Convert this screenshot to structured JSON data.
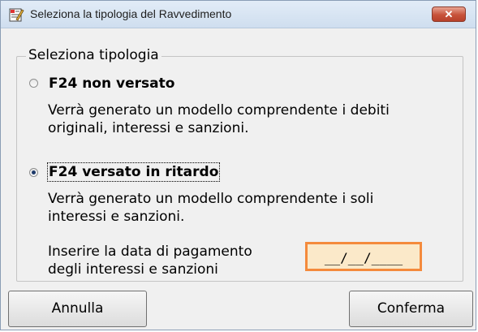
{
  "window": {
    "title": "Seleziona la tipologia del Ravvedimento",
    "icon": "edit-document-icon",
    "close_label": "✕"
  },
  "group": {
    "legend": "Seleziona tipologia"
  },
  "options": [
    {
      "label": "F24 non versato",
      "selected": false,
      "description_line1": "Verrà generato un modello comprendente i debiti",
      "description_line2": "originali, interessi e sanzioni."
    },
    {
      "label": "F24 versato in ritardo",
      "selected": true,
      "description_line1": "Verrà generato un modello comprendente i soli",
      "description_line2": "interessi e sanzioni."
    }
  ],
  "payment_date": {
    "label_line1": "Inserire la data di pagamento",
    "label_line2": "degli interessi e sanzioni",
    "value": "__/__/____",
    "highlight_color": "#f48a3c"
  },
  "buttons": {
    "cancel": "Annulla",
    "confirm": "Conferma"
  }
}
